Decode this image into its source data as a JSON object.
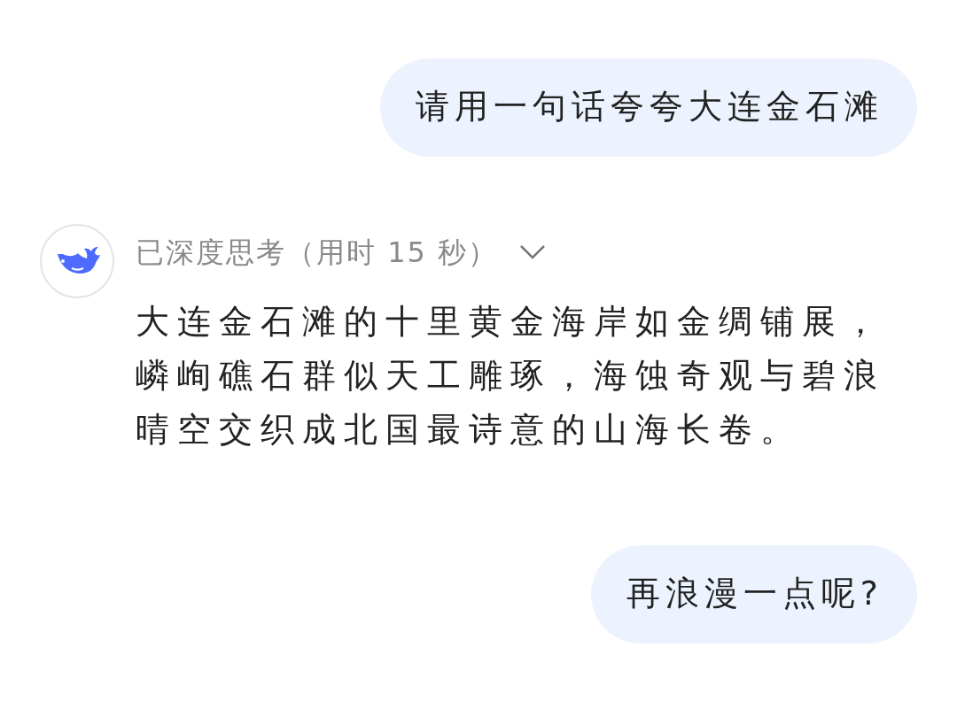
{
  "messages": [
    {
      "kind": "user",
      "text": "请用一句话夸夸大连金石滩"
    },
    {
      "kind": "assistant",
      "thought": "已深度思考（用时 15 秒）",
      "expanded": false,
      "text": "大连金石滩的十里黄金海岸如金绸铺展，嶙峋礁石群似天工雕琢，海蚀奇观与碧浪晴空交织成北国最诗意的山海长卷。"
    },
    {
      "kind": "user",
      "text": "再浪漫一点呢?"
    }
  ]
}
